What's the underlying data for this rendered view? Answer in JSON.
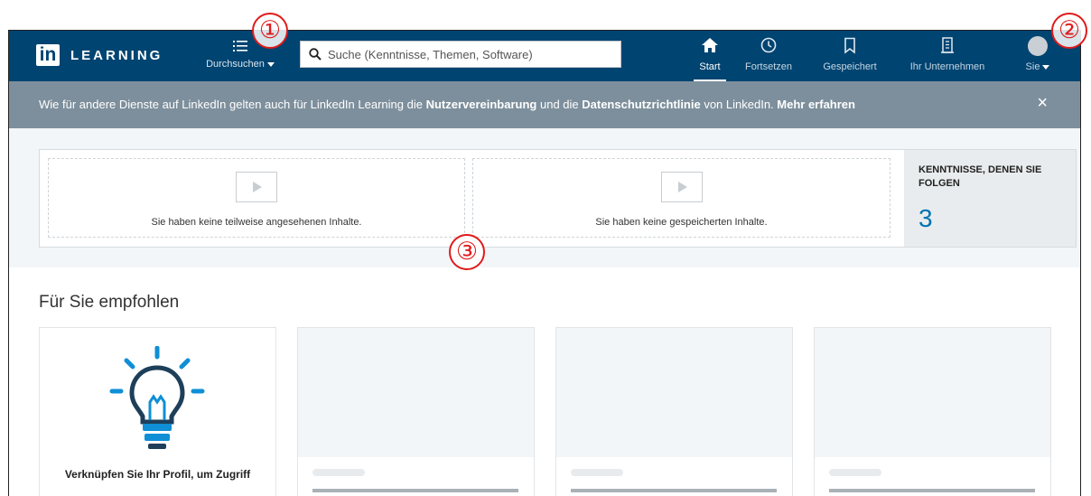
{
  "header": {
    "logo_in": "in",
    "logo_text": "LEARNING",
    "browse_label": "Durchsuchen",
    "browse_icon": "list-icon",
    "search_placeholder": "Suche (Kenntnisse, Themen, Software)",
    "search_icon": "search-icon",
    "nav": [
      {
        "label": "Start",
        "icon": "home-icon",
        "active": true
      },
      {
        "label": "Fortsetzen",
        "icon": "clock-icon",
        "active": false
      },
      {
        "label": "Gespeichert",
        "icon": "bookmark-icon",
        "active": false
      },
      {
        "label": "Ihr Unternehmen",
        "icon": "building-icon",
        "active": false
      },
      {
        "label": "Sie",
        "icon": "avatar-icon",
        "active": false
      }
    ],
    "bg_color": "#004471"
  },
  "notice": {
    "text_1": "Wie für andere Dienste auf LinkedIn gelten auch für LinkedIn Learning die ",
    "link_1": "Nutzervereinbarung",
    "text_2": " und die ",
    "link_2": "Datenschutzrichtlinie",
    "text_3": " von LinkedIn. ",
    "link_3": "Mehr erfahren",
    "close_icon": "×",
    "bg_color": "#7d8f9c"
  },
  "summary": {
    "partial_empty": "Sie haben keine teilweise angesehenen Inhalte.",
    "saved_empty": "Sie haben keine gespeicherten Inhalte.",
    "skills_title": "KENNTNISSE, DENEN SIE FOLGEN",
    "skills_count": "3",
    "accent_color": "#0073b1"
  },
  "recommendations": {
    "title": "Für Sie empfohlen",
    "first_card_text": "Verknüpfen Sie Ihr Profil, um Zugriff",
    "first_card_icon": "lightbulb-icon"
  },
  "annotations": {
    "marker_1": "①",
    "marker_2": "②",
    "marker_3": "③",
    "color": "#e01b1b"
  }
}
